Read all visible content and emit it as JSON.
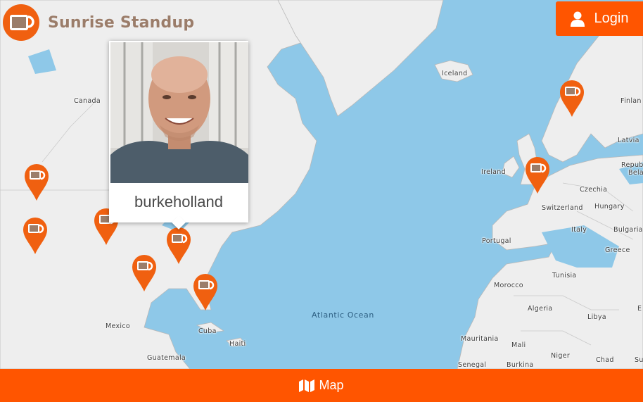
{
  "app": {
    "title": "Sunrise Standup"
  },
  "header": {
    "login_label": "Login"
  },
  "popup": {
    "username": "burkeholland"
  },
  "map_labels": {
    "canada": "Canada",
    "iceland": "Iceland",
    "finland": "Finlan",
    "latvia": "Latvia",
    "ireland": "Ireland",
    "czechia": "Czechia",
    "republic": "Repub",
    "belarus": "Bela",
    "switzerland": "Switzerland",
    "hungary": "Hungary",
    "portugal": "Portugal",
    "italy": "Italy",
    "bulgaria": "Bulgaria",
    "greece": "Greece",
    "tunisia": "Tunisia",
    "morocco": "Morocco",
    "algeria": "Algeria",
    "libya": "Libya",
    "egypt": "E",
    "atlantic": "Atlantic Ocean",
    "mexico": "Mexico",
    "cuba": "Cuba",
    "haiti": "Haiti",
    "guatemala": "Guatemala",
    "mauritania": "Mauritania",
    "mali": "Mali",
    "niger": "Niger",
    "chad": "Chad",
    "sudan": "Su",
    "senegal": "Senegal",
    "burkina": "Burkina"
  },
  "footer": {
    "nav_label": "Map",
    "icon": "map-icon"
  },
  "colors": {
    "accent": "#ff5500",
    "pin": "#f06010",
    "brand_text": "#9b7d6a",
    "water": "#8ec8e8",
    "land": "#eeeeee"
  }
}
